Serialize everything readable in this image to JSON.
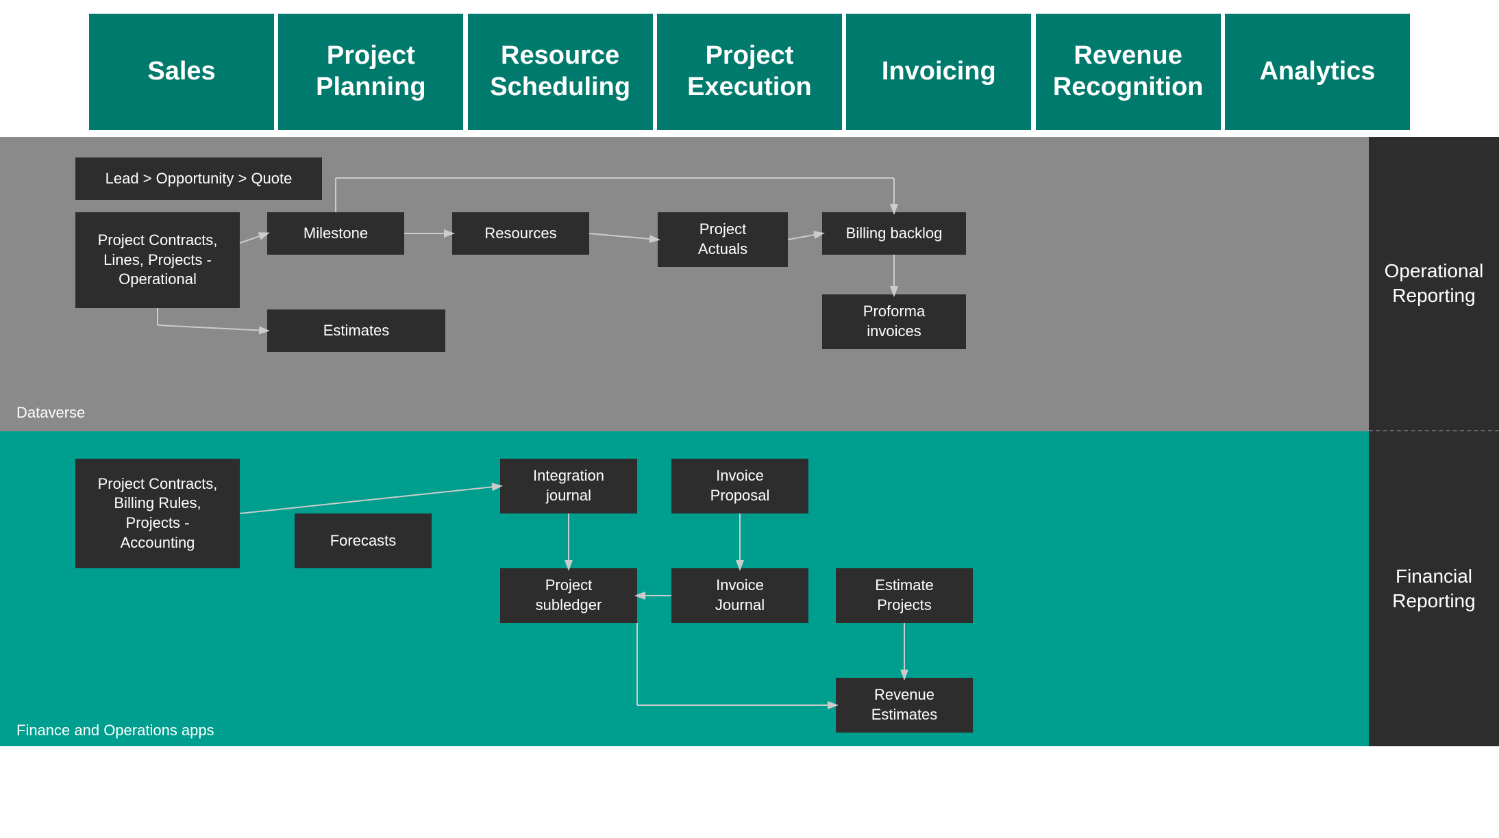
{
  "header": {
    "tiles": [
      {
        "label": "Sales"
      },
      {
        "label": "Project\nPlanning"
      },
      {
        "label": "Resource\nScheduling"
      },
      {
        "label": "Project\nExecution"
      },
      {
        "label": "Invoicing"
      },
      {
        "label": "Revenue\nRecognition"
      },
      {
        "label": "Analytics"
      }
    ]
  },
  "dataverse": {
    "label": "Dataverse",
    "boxes": {
      "lead": "Lead > Opportunity > Quote",
      "contracts": "Project Contracts,\nLines, Projects -\nOperational",
      "milestone": "Milestone",
      "resources": "Resources",
      "estimates": "Estimates",
      "projectActuals": "Project\nActuals",
      "billingBacklog": "Billing backlog",
      "proformaInvoices": "Proforma\ninvoices"
    }
  },
  "analytics": {
    "operationalReporting": "Operational\nReporting",
    "financialReporting": "Financial\nReporting"
  },
  "finance": {
    "label": "Finance and Operations apps",
    "boxes": {
      "projectContracts": "Project Contracts,\nBilling Rules,\nProjects -\nAccounting",
      "forecasts": "Forecasts",
      "integrationJournal": "Integration\njournal",
      "invoiceProposal": "Invoice\nProposal",
      "projectSubledger": "Project\nsubledger",
      "invoiceJournal": "Invoice\nJournal",
      "estimateProjects": "Estimate\nProjects",
      "revenueEstimates": "Revenue\nEstimates"
    }
  }
}
